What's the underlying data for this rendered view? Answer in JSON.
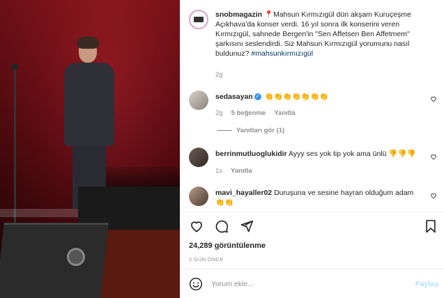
{
  "post": {
    "username": "snobmagazin",
    "pin": "📍",
    "caption": "Mahsun Kırmızıgül dün akşam Kuruçeşme Açıkhava'da konser verdi. 16 yıl sonra ilk konserini veren Kırmızıgül, sahnede Bergen'in \"Sen Affetsen Ben Affetmem\" şarkısını seslendirdi. Siz Mahsun Kırmızıgül yorumunu nasıl buldunuz?",
    "hashtag": "#mahsunkırmızıgül",
    "time": "2g"
  },
  "comments": [
    {
      "username": "sedasayan",
      "verified": "✓",
      "text": "👏👏👏👏👏👏👏",
      "time": "2g",
      "likes": "5 beğenme",
      "reply": "Yanıtla"
    },
    {
      "username": "berrinmutluoglukidir",
      "text": "Ayyy ses yok tip yok ama ünlü 👎👎👎",
      "time": "1s",
      "reply": "Yanıtla"
    },
    {
      "username": "mavi_hayaller02",
      "text": "Duruşuna ve sesine hayran olduğum adam 👏👏"
    }
  ],
  "view_replies": "Yanıtları gör (1)",
  "views": "24,289 görüntülenme",
  "date": "2 GÜN ÖNCE",
  "comment_input": {
    "placeholder": "Yorum ekle..."
  },
  "post_button": "Paylaş",
  "icons": {
    "like": "heart-icon",
    "comment": "comment-icon",
    "share": "share-icon",
    "save": "bookmark-icon",
    "emoji": "smile-icon"
  },
  "colors": {
    "link": "#00376b",
    "post_button": "#b2dffc",
    "muted": "#8e8e8e",
    "verified": "#3897f0"
  }
}
